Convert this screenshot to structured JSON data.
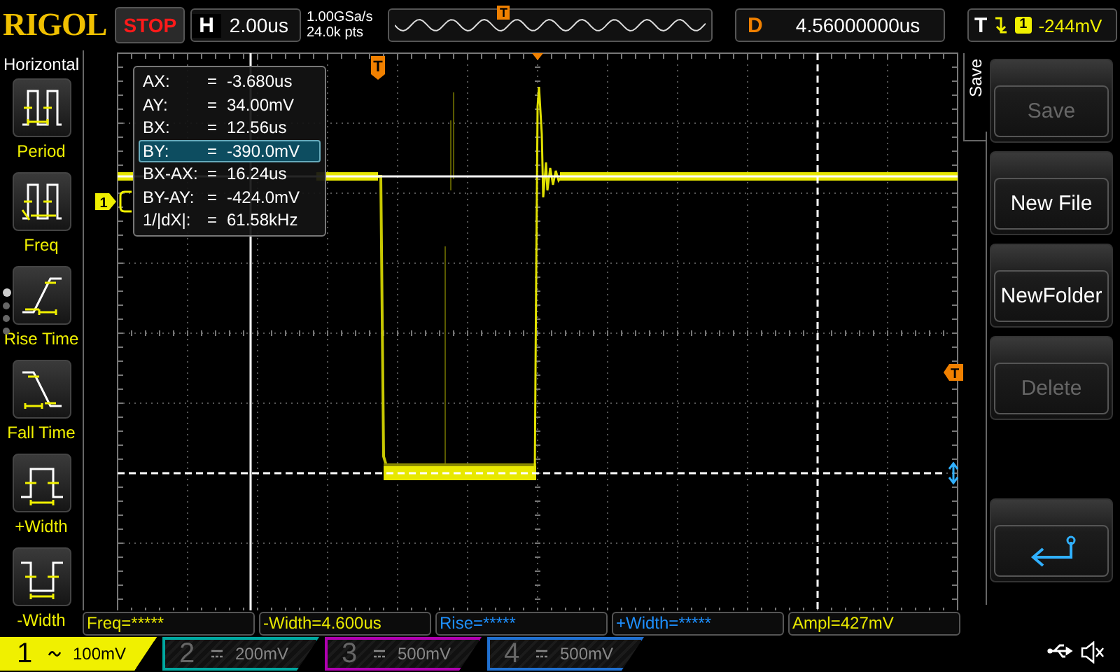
{
  "header": {
    "logo": "RIGOL",
    "run_state": "STOP",
    "timebase_label": "H",
    "timebase": "2.00us",
    "sample_rate": "1.00GSa/s",
    "memory_depth": "24.0k pts",
    "timeline_marker": "T",
    "delay_label": "D",
    "delay": "4.56000000us",
    "trigger_label": "T",
    "trigger_source": "1",
    "trigger_level": "-244mV"
  },
  "left_menu": {
    "title": "Horizontal",
    "page_dots": [
      {
        "selected": true
      },
      {
        "selected": false
      },
      {
        "selected": false
      },
      {
        "selected": false
      }
    ],
    "items": [
      {
        "label": "Period",
        "kind": "period"
      },
      {
        "label": "Freq",
        "kind": "freq"
      },
      {
        "label": "Rise Time",
        "kind": "rise"
      },
      {
        "label": "Fall Time",
        "kind": "fall"
      },
      {
        "label": "+Width",
        "kind": "pwidth"
      },
      {
        "label": "-Width",
        "kind": "nwidth"
      }
    ]
  },
  "cursor_readout": [
    {
      "label": "AX:",
      "sign": "=",
      "value": "-3.680us",
      "selected": false
    },
    {
      "label": "AY:",
      "sign": "=",
      "value": "34.00mV",
      "selected": false
    },
    {
      "label": "BX:",
      "sign": "=",
      "value": "12.56us",
      "selected": false
    },
    {
      "label": "BY:",
      "sign": "=",
      "value": "-390.0mV",
      "selected": true
    },
    {
      "label": "BX-AX:",
      "sign": "=",
      "value": "16.24us",
      "selected": false
    },
    {
      "label": "BY-AY:",
      "sign": "=",
      "value": "-424.0mV",
      "selected": false
    },
    {
      "label": "1/|dX|:",
      "sign": "=",
      "value": "61.58kHz",
      "selected": false
    }
  ],
  "screen": {
    "trigger_marker": "T",
    "channel_marker": "1",
    "trigger_level_marker": "T"
  },
  "right_menu": {
    "title": "Save",
    "buttons": [
      {
        "kind": "text",
        "label": "Save",
        "disabled": true
      },
      {
        "kind": "text",
        "label": "New File",
        "disabled": false
      },
      {
        "kind": "text",
        "label": "NewFolder",
        "disabled": false
      },
      {
        "kind": "text",
        "label": "Delete",
        "disabled": true
      },
      {
        "kind": "back",
        "disabled": false
      }
    ]
  },
  "measurements": [
    {
      "text": "Freq=*****",
      "color": "#e8e800"
    },
    {
      "text": "-Width=4.600us",
      "color": "#e8e800"
    },
    {
      "text": "Rise=*****",
      "color": "#1e90ff"
    },
    {
      "text": "+Width=*****",
      "color": "#1e90ff"
    },
    {
      "text": "Ampl=427mV",
      "color": "#e8e800"
    }
  ],
  "channels": [
    {
      "number": "1",
      "kind": "ac",
      "scale": "100mV",
      "on": true,
      "color": "#f0f000"
    },
    {
      "number": "2",
      "kind": "dc",
      "scale": "200mV",
      "on": false,
      "color": "#00a8a0"
    },
    {
      "number": "3",
      "kind": "dc",
      "scale": "500mV",
      "on": false,
      "color": "#b000b0"
    },
    {
      "number": "4",
      "kind": "dc",
      "scale": "500mV",
      "on": false,
      "color": "#2070d0"
    }
  ]
}
